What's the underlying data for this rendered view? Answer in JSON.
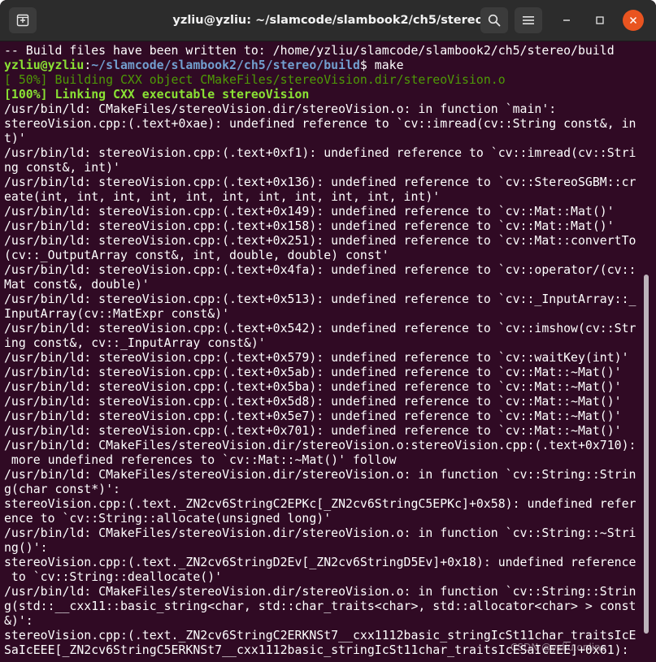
{
  "window": {
    "title": "yzliu@yzliu: ~/slamcode/slambook2/ch5/stereo",
    "icons": {
      "new_tab": "new-tab-icon",
      "search": "search-icon",
      "menu": "hamburger-menu-icon",
      "minimize": "minimize-icon",
      "maximize": "maximize-icon",
      "close": "close-icon"
    }
  },
  "colors": {
    "terminal_bg": "#300a24",
    "titlebar_bg": "#2c2c2c",
    "prompt_user": "#8ae234",
    "prompt_path": "#729fcf",
    "progress_text": "#4e9a06",
    "close_button": "#e95420"
  },
  "terminal": {
    "lines": [
      "-- Build files have been written to: /home/yzliu/slamcode/slambook2/ch5/stereo/build",
      "",
      "[ 50%] Building CXX object CMakeFiles/stereoVision.dir/stereoVision.o",
      "[100%] Linking CXX executable stereoVision",
      "/usr/bin/ld: CMakeFiles/stereoVision.dir/stereoVision.o: in function `main':",
      "stereoVision.cpp:(.text+0xae): undefined reference to `cv::imread(cv::String const&, in",
      "t)'",
      "/usr/bin/ld: stereoVision.cpp:(.text+0xf1): undefined reference to `cv::imread(cv::Stri",
      "ng const&, int)'",
      "/usr/bin/ld: stereoVision.cpp:(.text+0x136): undefined reference to `cv::StereoSGBM::cr",
      "eate(int, int, int, int, int, int, int, int, int, int, int)'",
      "/usr/bin/ld: stereoVision.cpp:(.text+0x149): undefined reference to `cv::Mat::Mat()'",
      "/usr/bin/ld: stereoVision.cpp:(.text+0x158): undefined reference to `cv::Mat::Mat()'",
      "/usr/bin/ld: stereoVision.cpp:(.text+0x251): undefined reference to `cv::Mat::convertTo",
      "(cv::_OutputArray const&, int, double, double) const'",
      "/usr/bin/ld: stereoVision.cpp:(.text+0x4fa): undefined reference to `cv::operator/(cv::",
      "Mat const&, double)'",
      "/usr/bin/ld: stereoVision.cpp:(.text+0x513): undefined reference to `cv::_InputArray::_",
      "InputArray(cv::MatExpr const&)'",
      "/usr/bin/ld: stereoVision.cpp:(.text+0x542): undefined reference to `cv::imshow(cv::Str",
      "ing const&, cv::_InputArray const&)'",
      "/usr/bin/ld: stereoVision.cpp:(.text+0x579): undefined reference to `cv::waitKey(int)'",
      "/usr/bin/ld: stereoVision.cpp:(.text+0x5ab): undefined reference to `cv::Mat::~Mat()'",
      "/usr/bin/ld: stereoVision.cpp:(.text+0x5ba): undefined reference to `cv::Mat::~Mat()'",
      "/usr/bin/ld: stereoVision.cpp:(.text+0x5d8): undefined reference to `cv::Mat::~Mat()'",
      "/usr/bin/ld: stereoVision.cpp:(.text+0x5e7): undefined reference to `cv::Mat::~Mat()'",
      "/usr/bin/ld: stereoVision.cpp:(.text+0x701): undefined reference to `cv::Mat::~Mat()'",
      "/usr/bin/ld: CMakeFiles/stereoVision.dir/stereoVision.o:stereoVision.cpp:(.text+0x710):",
      " more undefined references to `cv::Mat::~Mat()' follow",
      "/usr/bin/ld: CMakeFiles/stereoVision.dir/stereoVision.o: in function `cv::String::Strin",
      "g(char const*)':",
      "stereoVision.cpp:(.text._ZN2cv6StringC2EPKc[_ZN2cv6StringC5EPKc]+0x58): undefined refer",
      "ence to `cv::String::allocate(unsigned long)'",
      "/usr/bin/ld: CMakeFiles/stereoVision.dir/stereoVision.o: in function `cv::String::~Stri",
      "ng()':",
      "stereoVision.cpp:(.text._ZN2cv6StringD2Ev[_ZN2cv6StringD5Ev]+0x18): undefined reference",
      " to `cv::String::deallocate()'",
      "/usr/bin/ld: CMakeFiles/stereoVision.dir/stereoVision.o: in function `cv::String::Strin",
      "g(std::__cxx11::basic_string<char, std::char_traits<char>, std::allocator<char> > const",
      "&)':",
      "stereoVision.cpp:(.text._ZN2cv6StringC2ERKNSt7__cxx1112basic_stringIcSt11char_traitsIcE",
      "SaIcEEE[_ZN2cv6StringC5ERKNSt7__cxx1112basic_stringIcSt11char_traitsIcESaIcEEE]+0x61):"
    ],
    "prompt": {
      "user": "yzliu@yzliu",
      "sep": ":",
      "path": "~/slamcode/slambook2/ch5/stereo/build",
      "symbol": "$ ",
      "command": "make"
    }
  },
  "watermark": "CSDN @yzliu.online"
}
